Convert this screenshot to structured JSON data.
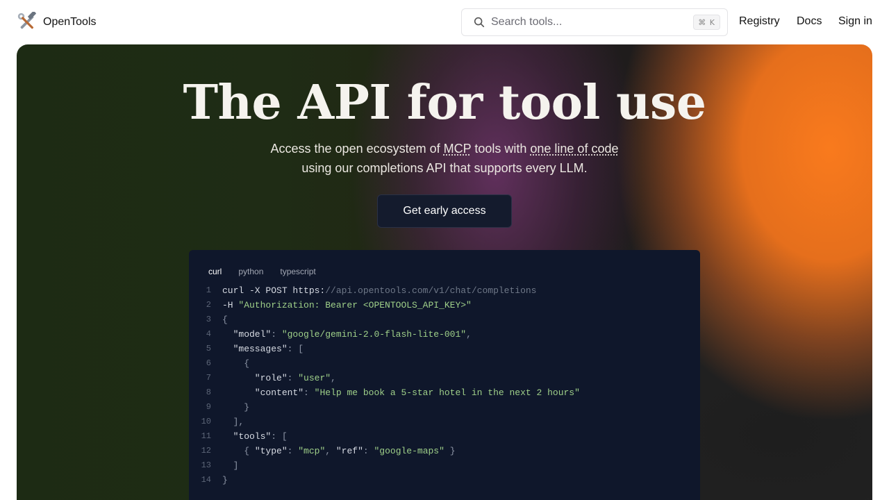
{
  "header": {
    "brand": "OpenTools",
    "logo_icon": "hammer-wrench-icon",
    "search": {
      "placeholder": "Search tools...",
      "shortcut": "⌘ K"
    },
    "nav": {
      "registry": "Registry",
      "docs": "Docs",
      "sign_in": "Sign in"
    }
  },
  "hero": {
    "title": "The API for tool use",
    "subtitle_line1_pre": "Access the open ecosystem of ",
    "subtitle_mcp": "MCP",
    "subtitle_line1_mid": " tools with ",
    "subtitle_one_line": "one line of code",
    "subtitle_line2": "using our completions API that supports every LLM.",
    "cta": "Get early access"
  },
  "code": {
    "tabs": [
      {
        "label": "curl",
        "active": true
      },
      {
        "label": "python",
        "active": false
      },
      {
        "label": "typescript",
        "active": false
      }
    ],
    "lines": [
      {
        "n": "1",
        "parts": [
          {
            "t": "curl -X POST https:",
            "c": "k"
          },
          {
            "t": "//api.opentools.com/v1/chat/completions",
            "c": "u"
          }
        ]
      },
      {
        "n": "2",
        "parts": [
          {
            "t": "-H ",
            "c": "k"
          },
          {
            "t": "\"Authorization: Bearer <OPENTOOLS_API_KEY>\"",
            "c": "s"
          }
        ]
      },
      {
        "n": "3",
        "parts": [
          {
            "t": "{",
            "c": "p"
          }
        ]
      },
      {
        "n": "4",
        "parts": [
          {
            "t": "  \"model\"",
            "c": "k"
          },
          {
            "t": ": ",
            "c": "p"
          },
          {
            "t": "\"google/gemini-2.0-flash-lite-001\"",
            "c": "s"
          },
          {
            "t": ",",
            "c": "p"
          }
        ]
      },
      {
        "n": "5",
        "parts": [
          {
            "t": "  \"messages\"",
            "c": "k"
          },
          {
            "t": ": [",
            "c": "p"
          }
        ]
      },
      {
        "n": "6",
        "parts": [
          {
            "t": "    {",
            "c": "p"
          }
        ]
      },
      {
        "n": "7",
        "parts": [
          {
            "t": "      \"role\"",
            "c": "k"
          },
          {
            "t": ": ",
            "c": "p"
          },
          {
            "t": "\"user\"",
            "c": "s"
          },
          {
            "t": ",",
            "c": "p"
          }
        ]
      },
      {
        "n": "8",
        "parts": [
          {
            "t": "      \"content\"",
            "c": "k"
          },
          {
            "t": ": ",
            "c": "p"
          },
          {
            "t": "\"Help me book a 5-star hotel in the next 2 hours\"",
            "c": "s"
          }
        ]
      },
      {
        "n": "9",
        "parts": [
          {
            "t": "    }",
            "c": "p"
          }
        ]
      },
      {
        "n": "10",
        "parts": [
          {
            "t": "  ],",
            "c": "p"
          }
        ]
      },
      {
        "n": "11",
        "parts": [
          {
            "t": "  \"tools\"",
            "c": "k"
          },
          {
            "t": ": [",
            "c": "p"
          }
        ]
      },
      {
        "n": "12",
        "parts": [
          {
            "t": "    { ",
            "c": "p"
          },
          {
            "t": "\"type\"",
            "c": "k"
          },
          {
            "t": ": ",
            "c": "p"
          },
          {
            "t": "\"mcp\"",
            "c": "s"
          },
          {
            "t": ", ",
            "c": "p"
          },
          {
            "t": "\"ref\"",
            "c": "k"
          },
          {
            "t": ": ",
            "c": "p"
          },
          {
            "t": "\"google-maps\"",
            "c": "s"
          },
          {
            "t": " }",
            "c": "p"
          }
        ]
      },
      {
        "n": "13",
        "parts": [
          {
            "t": "  ]",
            "c": "p"
          }
        ]
      },
      {
        "n": "14",
        "parts": [
          {
            "t": "}",
            "c": "p"
          }
        ]
      }
    ]
  },
  "colors": {
    "hero_green": "#1d2b14",
    "hero_orange": "#f97a1d",
    "hero_purple": "#6c3269",
    "code_bg": "#0f172b",
    "code_string": "#9fd089",
    "cta_bg": "#141b2d"
  }
}
